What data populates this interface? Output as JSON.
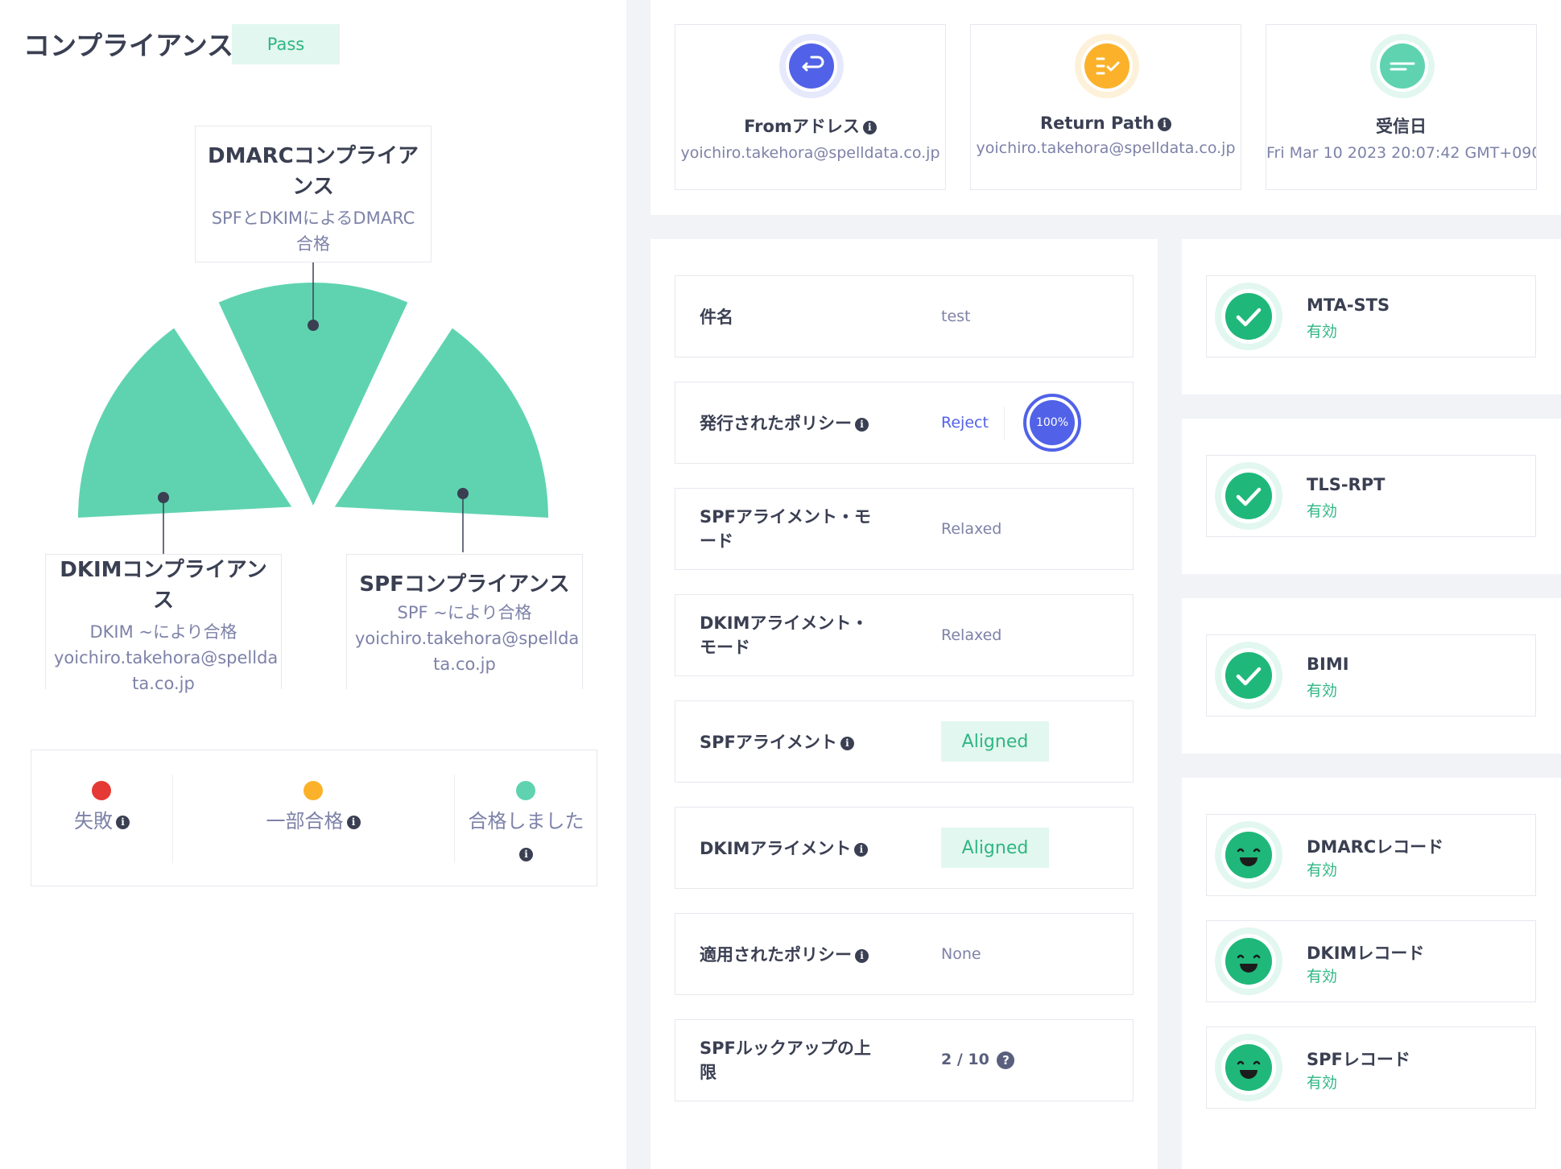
{
  "compliance": {
    "title": "コンプライアンス",
    "status": "Pass",
    "dmarc": {
      "title": "DMARCコンプライアンス",
      "subtitle": "SPFとDKIMによるDMARC合格"
    },
    "dkim": {
      "title": "DKIMコンプライアンス",
      "subtitle": "DKIM ~により合格",
      "domain": "yoichiro.takehora@spellda ta.co.jp"
    },
    "spf": {
      "title": "SPFコンプライアンス",
      "subtitle": "SPF ~により合格",
      "domain": "yoichiro.takehora@spellda ta.co.jp"
    },
    "legend": [
      {
        "label": "失敗",
        "color": "#e53935"
      },
      {
        "label": "一部合格",
        "color": "#fbb22a"
      },
      {
        "label": "合格しました",
        "color": "#5fd3b0"
      }
    ],
    "gauge_color": "#5fd3b0"
  },
  "header_cards": [
    {
      "title": "Fromアドレス",
      "value": "yoichiro.takehora@spelldata.co.jp",
      "icon": "reply-icon",
      "color": "#5162e8"
    },
    {
      "title": "Return Path",
      "value": "yoichiro.takehora@spelldata.co.jp",
      "icon": "checklist-icon",
      "color": "#fbb22a"
    },
    {
      "title": "受信日",
      "value": "Fri Mar 10 2023 20:07:42 GMT+090",
      "icon": "text-lines-icon",
      "color": "#5fd3b0"
    }
  ],
  "details": {
    "subject": {
      "label": "件名",
      "value": "test"
    },
    "published_policy": {
      "label": "発行されたポリシー",
      "value": "Reject",
      "percent": "100%"
    },
    "spf_alignment_mode": {
      "label": "SPFアライメント・モード",
      "value": "Relaxed"
    },
    "dkim_alignment_mode": {
      "label": "DKIMアライメント・モード",
      "value": "Relaxed"
    },
    "spf_alignment": {
      "label": "SPFアライメント",
      "value": "Aligned"
    },
    "dkim_alignment": {
      "label": "DKIMアライメント",
      "value": "Aligned"
    },
    "applied_policy": {
      "label": "適用されたポリシー",
      "value": "None"
    },
    "spf_lookup": {
      "label": "SPFルックアップの上限",
      "value": "2 / 10"
    }
  },
  "statuses": [
    {
      "title": "MTA-STS",
      "value": "有効",
      "icon": "check-icon"
    },
    {
      "title": "TLS-RPT",
      "value": "有効",
      "icon": "check-icon"
    },
    {
      "title": "BIMI",
      "value": "有効",
      "icon": "check-icon"
    }
  ],
  "records": [
    {
      "title": "DMARCレコード",
      "value": "有効",
      "icon": "smile-icon"
    },
    {
      "title": "DKIMレコード",
      "value": "有効",
      "icon": "smile-icon"
    },
    {
      "title": "SPFレコード",
      "value": "有効",
      "icon": "smile-icon"
    }
  ]
}
